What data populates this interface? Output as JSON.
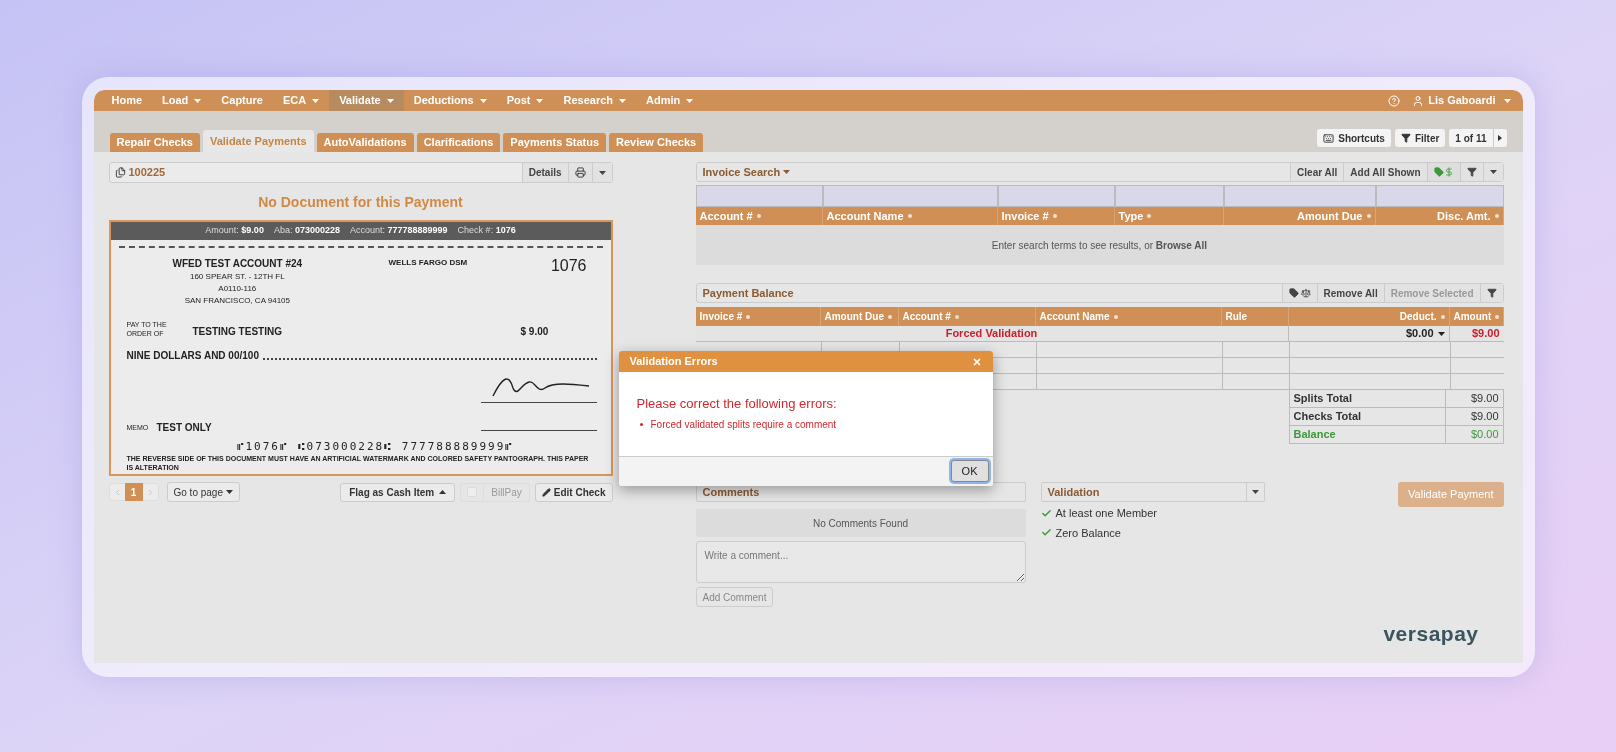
{
  "nav": {
    "items": [
      {
        "label": "Home",
        "dropdown": false,
        "selected": false
      },
      {
        "label": "Load",
        "dropdown": true,
        "selected": false
      },
      {
        "label": "Capture",
        "dropdown": false,
        "selected": false
      },
      {
        "label": "ECA",
        "dropdown": true,
        "selected": false
      },
      {
        "label": "Validate",
        "dropdown": true,
        "selected": true
      },
      {
        "label": "Deductions",
        "dropdown": true,
        "selected": false
      },
      {
        "label": "Post",
        "dropdown": true,
        "selected": false
      },
      {
        "label": "Research",
        "dropdown": true,
        "selected": false
      },
      {
        "label": "Admin",
        "dropdown": true,
        "selected": false
      }
    ],
    "user": "Lis Gaboardi"
  },
  "tabs": [
    {
      "label": "Repair Checks",
      "selected": false
    },
    {
      "label": "Validate Payments",
      "selected": true
    },
    {
      "label": "AutoValidations",
      "selected": false
    },
    {
      "label": "Clarifications",
      "selected": false
    },
    {
      "label": "Payments Status",
      "selected": false
    },
    {
      "label": "Review Checks",
      "selected": false
    }
  ],
  "toolbar": {
    "shortcuts": "Shortcuts",
    "filter": "Filter",
    "pager": "1 of 11"
  },
  "document": {
    "id": "100225",
    "details": "Details",
    "message": "No Document for this Payment",
    "meta": [
      {
        "label": "Amount:",
        "value": "$9.00"
      },
      {
        "label": "Aba:",
        "value": "073000228"
      },
      {
        "label": "Account:",
        "value": "777788889999"
      },
      {
        "label": "Check #:",
        "value": "1076"
      }
    ],
    "check": {
      "payer": [
        "WFED TEST ACCOUNT #24",
        "160 SPEAR ST. - 12TH FL",
        "A0110-116",
        "SAN FRANCISCO, CA 94105"
      ],
      "bank": "WELLS FARGO DSM",
      "number": "1076",
      "pay_to_label": "PAY TO THE ORDER OF",
      "payee": "TESTING TESTING",
      "amount": "$ 9.00",
      "words": "NINE DOLLARS AND 00/100",
      "memo_label": "MEMO",
      "memo": "TEST ONLY",
      "micr": "⑈1076⑈ ⑆073000228⑆ 777788889999⑈",
      "footer": "THE REVERSE SIDE OF THIS DOCUMENT MUST HAVE AN ARTIFICIAL WATERMARK AND COLORED SAFETY PANTOGRAPH. THIS PAPER IS ALTERATION"
    }
  },
  "pager": {
    "pages": [
      {
        "label": "1",
        "selected": true
      }
    ],
    "goto": "Go to page",
    "flag": "Flag as Cash Item",
    "billpay": {
      "label": "BillPay",
      "checked": false
    },
    "edit": "Edit Check"
  },
  "invoice_search": {
    "title": "Invoice Search",
    "buttons": [
      "Clear All",
      "Add All Shown"
    ],
    "columns": [
      {
        "label": "Account #"
      },
      {
        "label": "Account Name"
      },
      {
        "label": "Invoice #"
      },
      {
        "label": "Type"
      },
      {
        "label": "Amount Due"
      },
      {
        "label": "Disc. Amt."
      }
    ],
    "empty": "Enter search terms to see results, or **Browse All**"
  },
  "payment_balance": {
    "title": "Payment Balance",
    "buttons": [
      {
        "label": "Remove All",
        "disabled": false
      },
      {
        "label": "Remove Selected",
        "disabled": true
      }
    ],
    "columns": [
      {
        "label": "Invoice #",
        "sortable": true
      },
      {
        "label": "Amount Due",
        "sortable": true
      },
      {
        "label": "Account #",
        "sortable": true
      },
      {
        "label": "Account Name",
        "sortable": true
      },
      {
        "label": "Rule",
        "sortable": false
      },
      {
        "label": "Deduct.",
        "sortable": true
      },
      {
        "label": "Amount",
        "sortable": true
      }
    ],
    "rows": [
      {
        "rule": "Forced Validation",
        "deduct": "$0.00",
        "amount": "$9.00"
      }
    ],
    "totals": [
      {
        "label": "Splits Total",
        "value": "$9.00",
        "kind": "normal"
      },
      {
        "label": "Checks Total",
        "value": "$9.00",
        "kind": "normal"
      },
      {
        "label": "Balance",
        "value": "$0.00",
        "kind": "balance"
      }
    ]
  },
  "comments": {
    "title": "Comments",
    "empty": "No Comments Found",
    "placeholder": "Write a comment...",
    "button": "Add Comment"
  },
  "validation": {
    "title": "Validation",
    "checks": [
      {
        "label": "At least one Member",
        "passed": true
      },
      {
        "label": "Zero Balance",
        "passed": true
      }
    ],
    "button": {
      "label": "Validate Payment",
      "disabled": true
    }
  },
  "dialog": {
    "title": "Validation Errors",
    "heading": "Please correct the following errors:",
    "errors": [
      "Forced validated splits require a comment"
    ],
    "button": "OK"
  },
  "logo": {
    "text": "versapay"
  }
}
